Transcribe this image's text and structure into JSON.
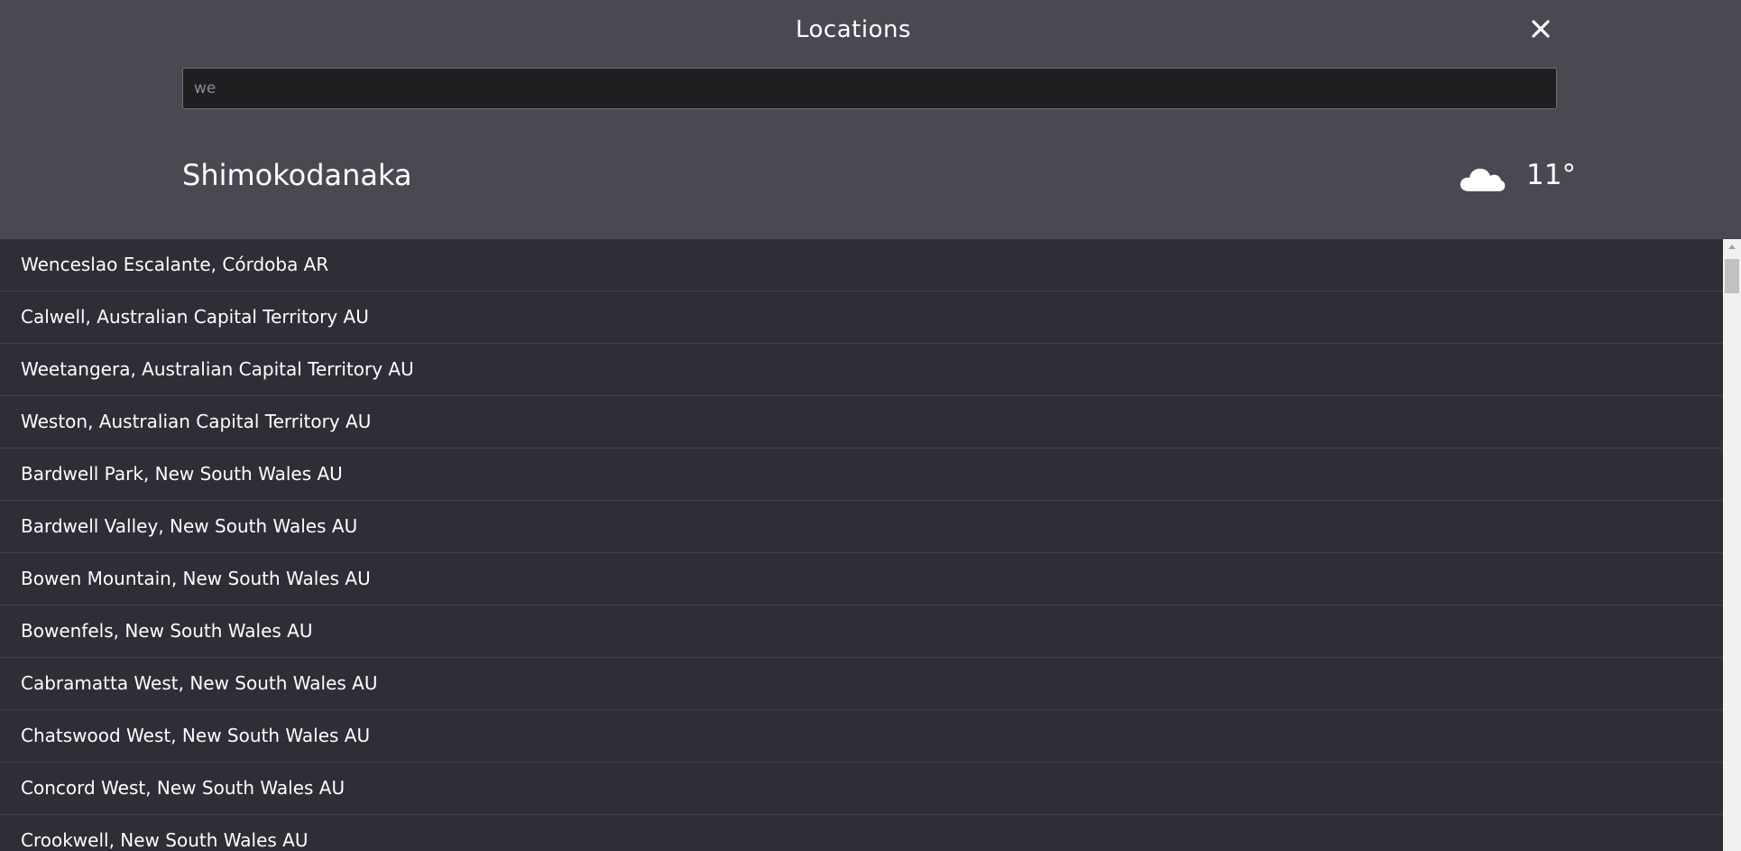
{
  "header": {
    "title": "Locations",
    "close_icon": "close-icon"
  },
  "search": {
    "value": "we",
    "placeholder": ""
  },
  "current_location": {
    "city": "Shimokodanaka",
    "weather_icon": "cloud-icon",
    "temperature": "11°"
  },
  "results": [
    "Wenceslao Escalante, Córdoba AR",
    "Calwell, Australian Capital Territory AU",
    "Weetangera, Australian Capital Territory AU",
    "Weston, Australian Capital Territory AU",
    "Bardwell Park, New South Wales AU",
    "Bardwell Valley, New South Wales AU",
    "Bowen Mountain, New South Wales AU",
    "Bowenfels, New South Wales AU",
    "Cabramatta West, New South Wales AU",
    "Chatswood West, New South Wales AU",
    "Concord West, New South Wales AU",
    "Crookwell, New South Wales AU"
  ],
  "colors": {
    "header_bg": "#4a4952",
    "list_bg": "#2e2e36",
    "input_bg": "#1f1f22",
    "text": "#ffffff"
  }
}
